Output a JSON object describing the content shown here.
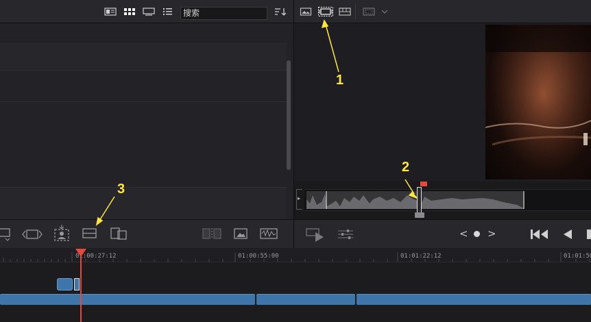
{
  "media_pool": {
    "search": {
      "value": "搜索"
    },
    "view_icons": [
      "metadata-view-icon",
      "thumbnail-view-icon",
      "filmstrip-view-icon",
      "list-view-icon",
      "sort-icon"
    ]
  },
  "viewer": {
    "toolbar_icons": [
      "image-view-icon",
      "clip-frame-icon",
      "multi-view-icon",
      "aspect-icon",
      "dropdown-chevron-icon"
    ],
    "transport": {
      "prev_label": "<",
      "next_label": ">"
    }
  },
  "timeline": {
    "timecodes": [
      "01:00:27:12",
      "01:00:55:00",
      "01:01:22:12",
      "01:01:50"
    ]
  },
  "annotations": {
    "label_1": "1",
    "label_2": "2",
    "label_3": "3"
  },
  "colors": {
    "accent_annotation": "#ffe640",
    "playhead": "#e5483f",
    "clip": "#3f76aa"
  }
}
